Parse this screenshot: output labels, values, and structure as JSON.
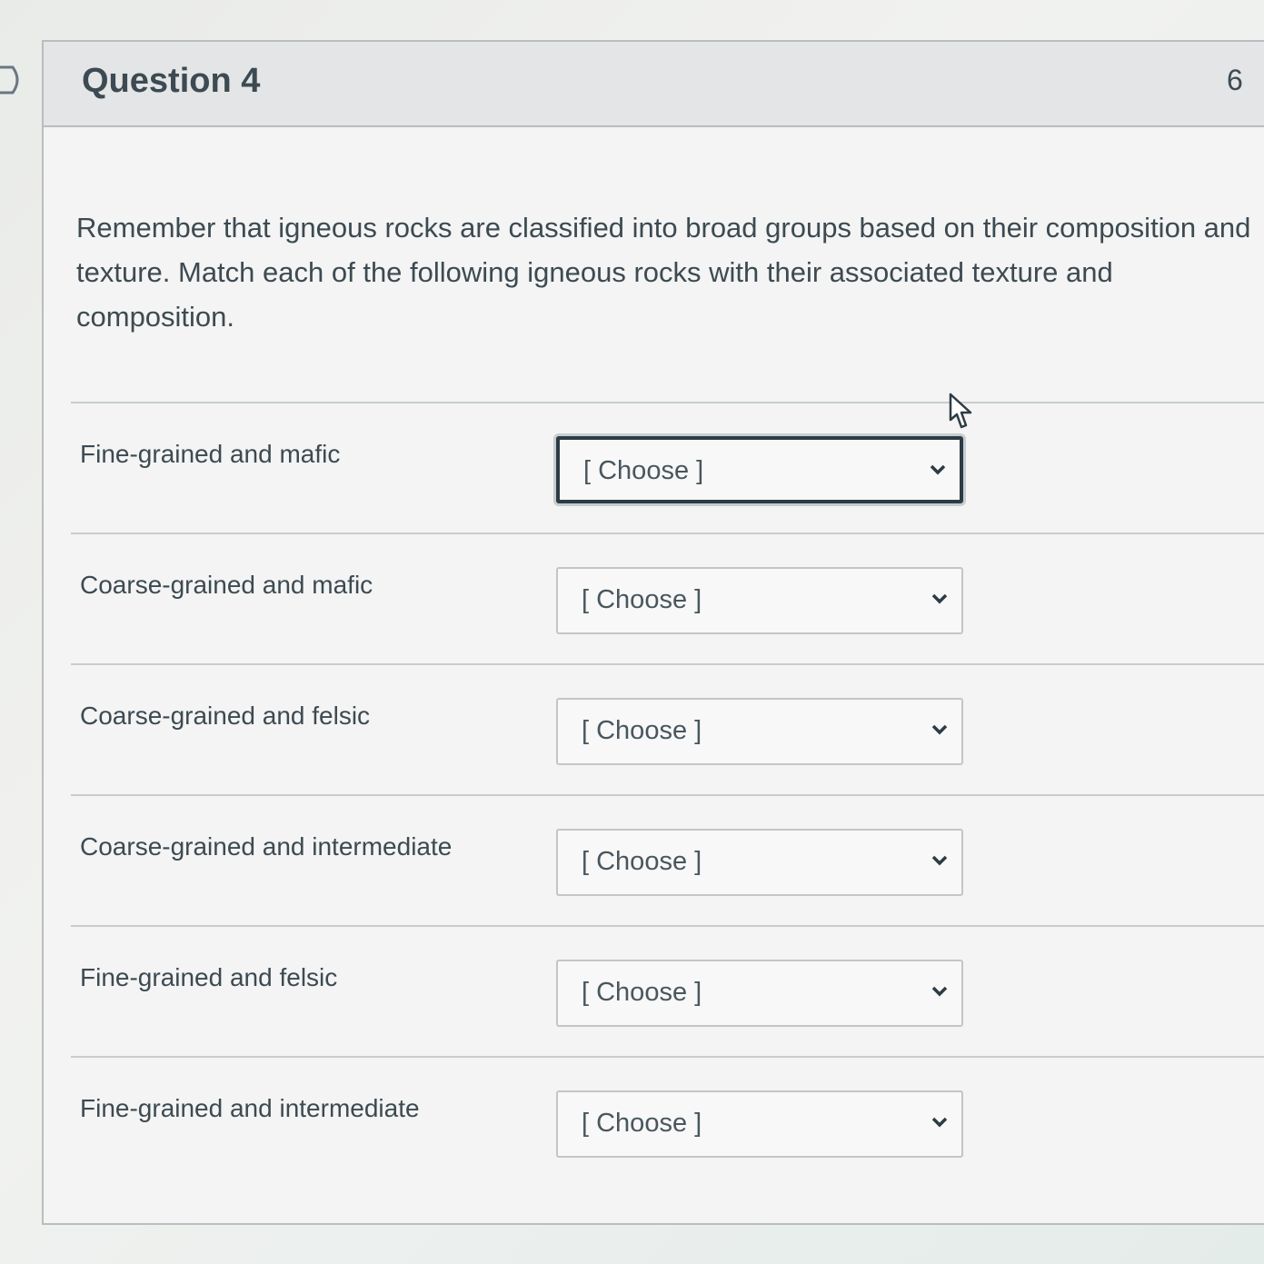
{
  "question": {
    "title": "Question 4",
    "points": "6",
    "text": "Remember that igneous rocks are classified into broad groups based on their composition and texture. Match each of the following igneous rocks with their associated texture and composition."
  },
  "matches": [
    {
      "label": "Fine-grained and mafic",
      "selected": "[ Choose ]"
    },
    {
      "label": "Coarse-grained and mafic",
      "selected": "[ Choose ]"
    },
    {
      "label": "Coarse-grained and felsic",
      "selected": "[ Choose ]"
    },
    {
      "label": "Coarse-grained and intermediate",
      "selected": "[ Choose ]"
    },
    {
      "label": "Fine-grained and felsic",
      "selected": "[ Choose ]"
    },
    {
      "label": "Fine-grained and intermediate",
      "selected": "[ Choose ]"
    }
  ],
  "icons": {
    "flag": "flag-icon",
    "chevron": "chevron-down-icon",
    "cursor": "mouse-pointer-icon"
  }
}
